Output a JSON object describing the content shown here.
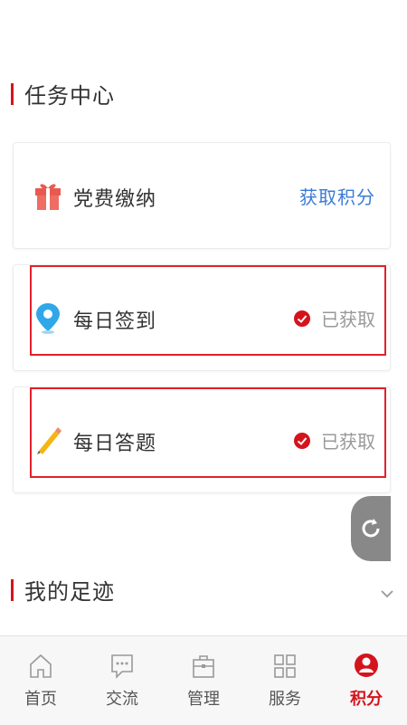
{
  "tasks": {
    "title": "任务中心",
    "items": [
      {
        "label": "党费缴纳",
        "action": "获取积分"
      },
      {
        "label": "每日签到",
        "status": "已获取"
      },
      {
        "label": "每日答题",
        "status": "已获取"
      }
    ]
  },
  "footprint": {
    "title": "我的足迹"
  },
  "tabs": [
    {
      "label": "首页"
    },
    {
      "label": "交流"
    },
    {
      "label": "管理"
    },
    {
      "label": "服务"
    },
    {
      "label": "积分"
    }
  ],
  "active_tab": "积分",
  "colors": {
    "accent": "#d4141c",
    "link": "#3a7bd5",
    "muted": "#999999"
  }
}
